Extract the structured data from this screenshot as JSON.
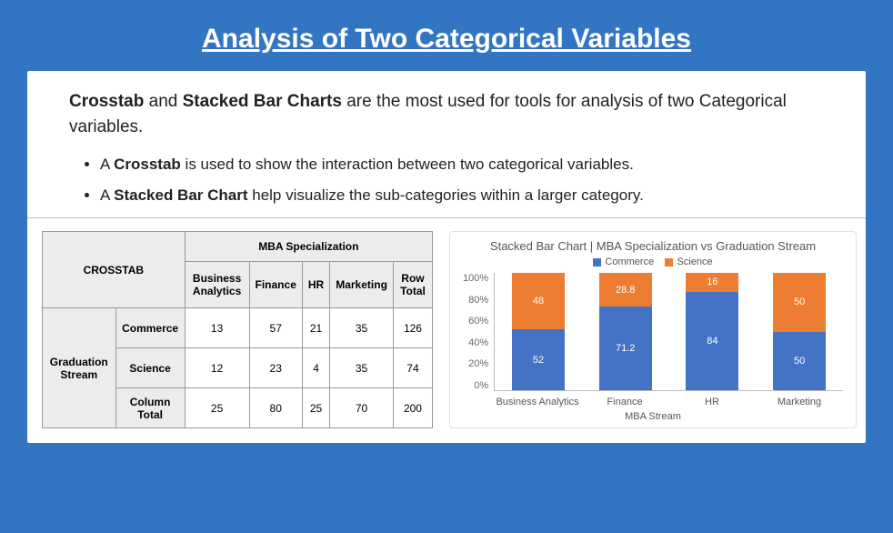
{
  "title": "Analysis of Two Categorical Variables",
  "intro": {
    "b1": "Crosstab",
    "mid1": " and ",
    "b2": "Stacked Bar Charts",
    "tail": " are the most used for tools for analysis of two Categorical variables."
  },
  "bullet1": {
    "prefix": "A ",
    "bold": "Crosstab",
    "rest": " is used to show the interaction between two categorical variables."
  },
  "bullet2": {
    "prefix": "A ",
    "bold": "Stacked Bar Chart",
    "rest": " help visualize the sub-categories within a larger category."
  },
  "table": {
    "corner": "CROSSTAB",
    "colgroup": "MBA Specialization",
    "rowgroup": "Graduation Stream",
    "cols": [
      "Business Analytics",
      "Finance",
      "HR",
      "Marketing",
      "Row Total"
    ],
    "rows": [
      "Commerce",
      "Science",
      "Column Total"
    ],
    "data": [
      [
        "13",
        "57",
        "21",
        "35",
        "126"
      ],
      [
        "12",
        "23",
        "4",
        "35",
        "74"
      ],
      [
        "25",
        "80",
        "25",
        "70",
        "200"
      ]
    ]
  },
  "chart_data": {
    "type": "bar",
    "title": "Stacked Bar Chart | MBA Specialization vs Graduation Stream",
    "xlabel": "MBA Stream",
    "ylabel": "",
    "ylim": [
      0,
      100
    ],
    "yticks": [
      "100%",
      "80%",
      "60%",
      "40%",
      "20%",
      "0%"
    ],
    "categories": [
      "Business Analytics",
      "Finance",
      "HR",
      "Marketing"
    ],
    "series": [
      {
        "name": "Commerce",
        "color": "#4472c4",
        "values": [
          52,
          71.2,
          84,
          50
        ]
      },
      {
        "name": "Science",
        "color": "#ed7d31",
        "values": [
          48,
          28.8,
          16,
          50
        ]
      }
    ],
    "legend": {
      "commerce": "Commerce",
      "science": "Science"
    }
  }
}
